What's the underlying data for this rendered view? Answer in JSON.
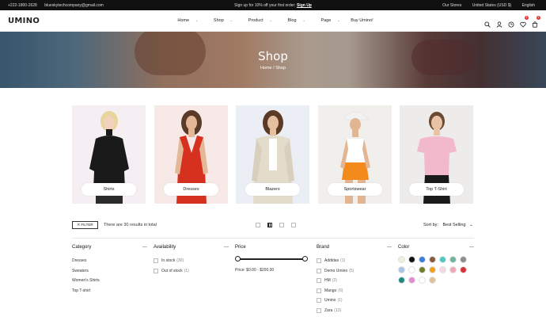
{
  "topbar": {
    "phone": "+222-1800-2628",
    "email": "blueskytechcompany@gmail.com",
    "promo_text": "Sign up for 10% off your first order:",
    "promo_link": "Sign Up",
    "stores": "Our Stores",
    "currency": "United States (USD $)",
    "language": "English"
  },
  "header": {
    "logo": "UMINO",
    "nav": [
      {
        "label": "Home",
        "dropdown": true
      },
      {
        "label": "Shop",
        "dropdown": true
      },
      {
        "label": "Product",
        "dropdown": true
      },
      {
        "label": "Blog",
        "dropdown": true
      },
      {
        "label": "Page",
        "dropdown": true
      },
      {
        "label": "Buy Umino!",
        "dropdown": false
      }
    ],
    "wishlist_count": "1",
    "cart_count": "1"
  },
  "hero": {
    "title": "Shop",
    "breadcrumb_home": "Home",
    "breadcrumb_sep": "/",
    "breadcrumb_current": "Shop"
  },
  "categories": [
    {
      "label": "Shirts",
      "bg": "#f5eef3"
    },
    {
      "label": "Dresses",
      "bg": "#f6e9e7"
    },
    {
      "label": "Blazers",
      "bg": "#eceef5"
    },
    {
      "label": "Sportswear",
      "bg": "#f1efec"
    },
    {
      "label": "Top T-Shirt",
      "bg": "#eeeceb"
    }
  ],
  "toolbar": {
    "filter_label": "FILTER",
    "results_text": "There are 30 results in total",
    "sort_label": "Sort by:",
    "sort_value": "Best Selling"
  },
  "filters": {
    "category": {
      "title": "Category",
      "items": [
        "Dresses",
        "Sweaters",
        "Women's Shirts",
        "Top T-shirt"
      ]
    },
    "availability": {
      "title": "Availability",
      "items": [
        {
          "label": "In stock",
          "count": "(30)"
        },
        {
          "label": "Out of stock",
          "count": "(1)"
        }
      ]
    },
    "price": {
      "title": "Price",
      "range_text": "Price: $0.00 - $200.00"
    },
    "brand": {
      "title": "Brand",
      "items": [
        {
          "label": "Addidas",
          "count": "(1)"
        },
        {
          "label": "Demo Umino",
          "count": "(5)"
        },
        {
          "label": "HM",
          "count": "(2)"
        },
        {
          "label": "Mango",
          "count": "(6)"
        },
        {
          "label": "Umino",
          "count": "(1)"
        },
        {
          "label": "Zara",
          "count": "(13)"
        }
      ]
    },
    "color": {
      "title": "Color",
      "swatches": [
        "#f2eedc",
        "#111111",
        "#3b7dd8",
        "#8a5a3c",
        "#4fc9c0",
        "#6fb59a",
        "#8d8d8d",
        "#a9c4e6",
        "#ffffff",
        "#6e7d2a",
        "#f2a01e",
        "#f5d7e0",
        "#f2a6b8",
        "#d8323c",
        "#1f8a82",
        "#e58bd6",
        "#ffffff",
        "#e2c09a"
      ]
    }
  }
}
